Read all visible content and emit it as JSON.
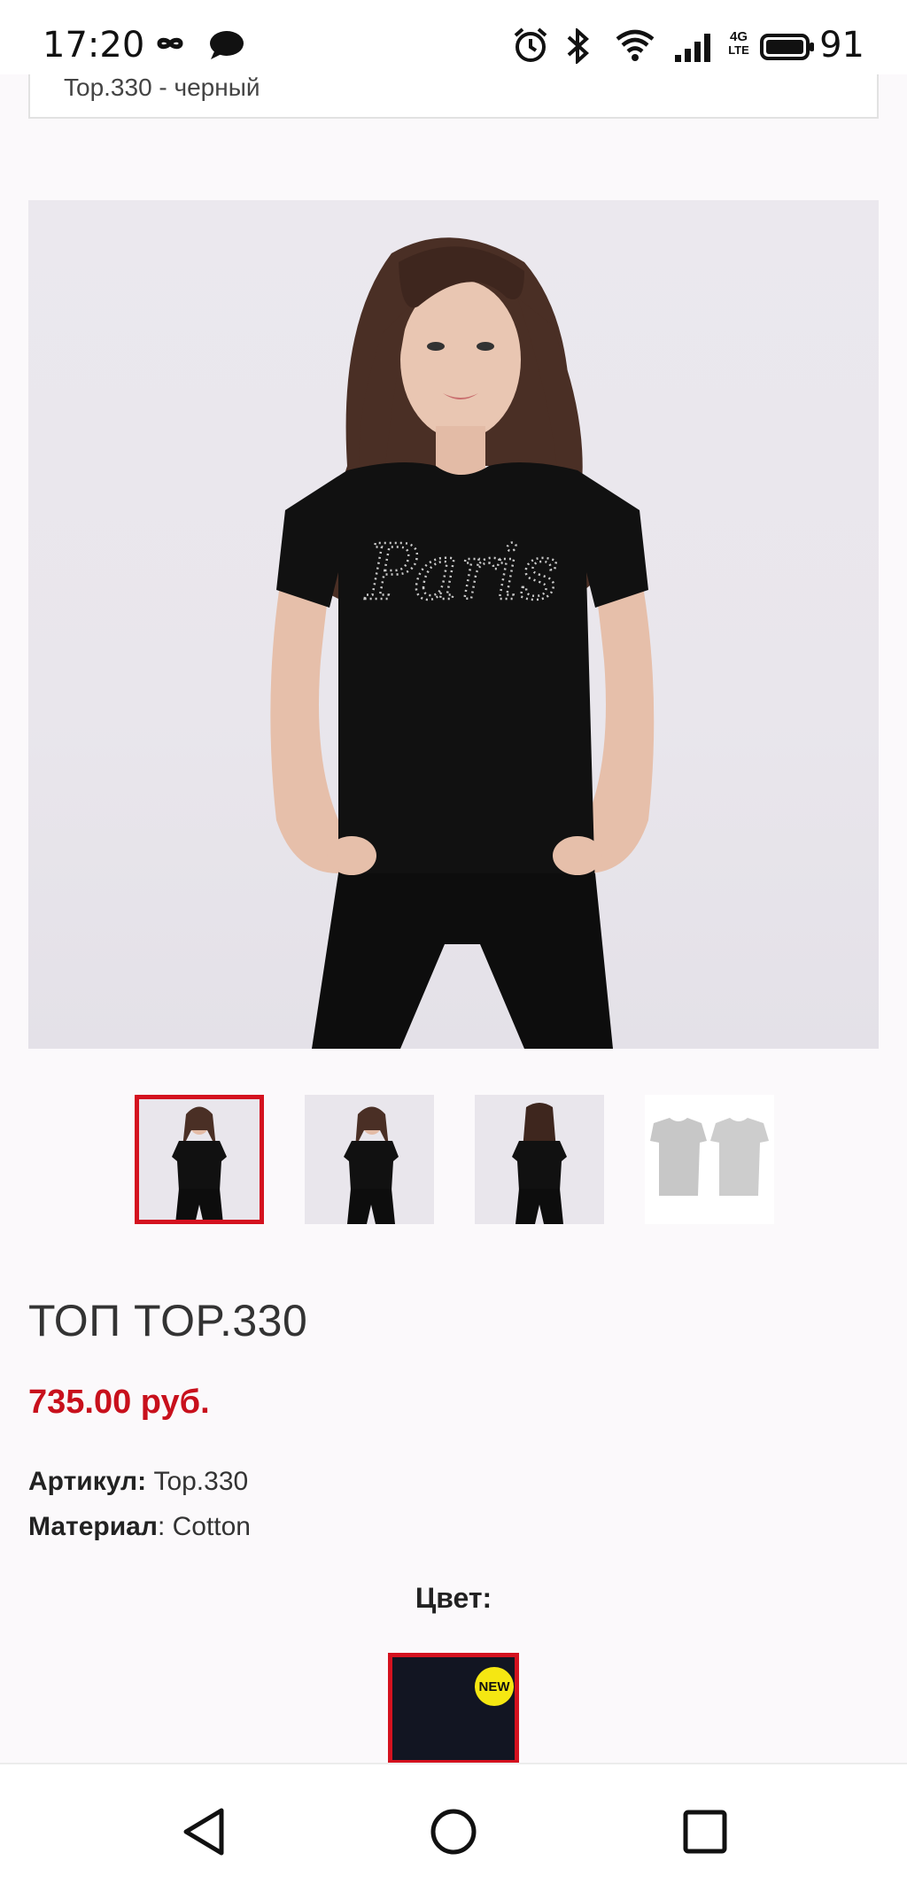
{
  "status_bar": {
    "time": "17:20",
    "battery_level": "91",
    "network_label_top": "4G",
    "network_label_bottom": "LTE"
  },
  "breadcrumb": {
    "text": "Top.330 - черный"
  },
  "hero_image": {
    "caption_on_shirt": "Paris"
  },
  "thumbnails": [
    {
      "name": "front-view",
      "active": true
    },
    {
      "name": "front-angle-view",
      "active": false
    },
    {
      "name": "back-view",
      "active": false
    },
    {
      "name": "flat-lay-view",
      "active": false
    }
  ],
  "product": {
    "title": "ТОП TOP.330",
    "price": "735.00 руб.",
    "article_label": "Артикул:",
    "article_value": "Top.330",
    "material_label": "Материал",
    "material_value": ": Cotton",
    "color_label": "Цвет:",
    "color_swatch_badge": "NEW"
  },
  "colors": {
    "accent_red": "#d4121f",
    "price_red": "#c8101c",
    "badge_yellow": "#f5e712",
    "swatch_color": "#121522"
  }
}
